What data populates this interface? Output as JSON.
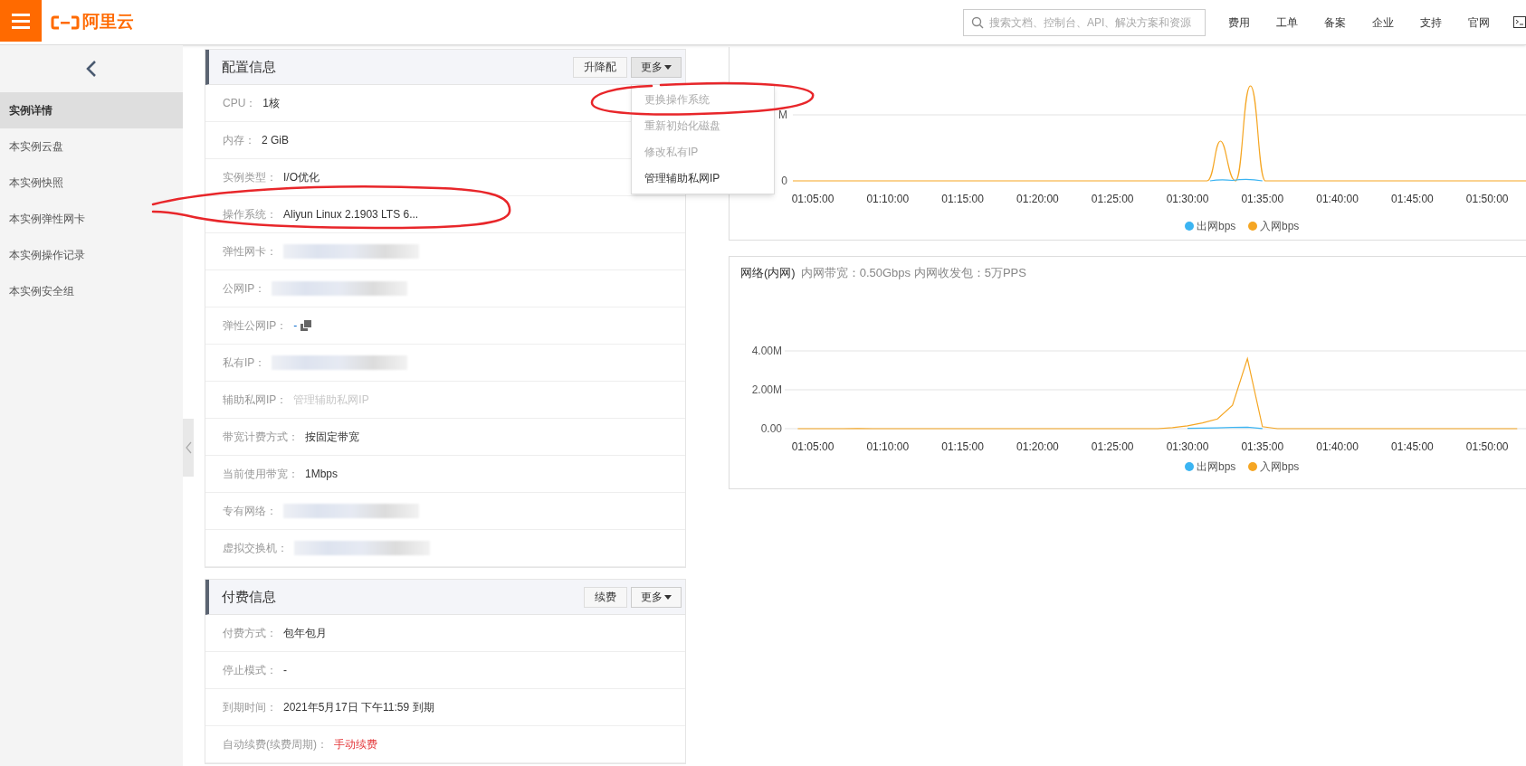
{
  "topbar": {
    "logo_text": "阿里云",
    "search": {
      "placeholder": "搜索文档、控制台、API、解决方案和资源"
    },
    "nav": [
      "费用",
      "工单",
      "备案",
      "企业",
      "支持",
      "官网"
    ]
  },
  "sidebar": {
    "items": [
      {
        "label": "实例详情",
        "selected": true
      },
      {
        "label": "本实例云盘",
        "selected": false
      },
      {
        "label": "本实例快照",
        "selected": false
      },
      {
        "label": "本实例弹性网卡",
        "selected": false
      },
      {
        "label": "本实例操作记录",
        "selected": false
      },
      {
        "label": "本实例安全组",
        "selected": false
      }
    ]
  },
  "config_panel": {
    "title": "配置信息",
    "buttons": [
      "升降配",
      "更多"
    ],
    "menu": [
      {
        "label": "更换操作系统",
        "disabled": true
      },
      {
        "label": "重新初始化磁盘",
        "disabled": true
      },
      {
        "label": "修改私有IP",
        "disabled": true
      },
      {
        "label": "管理辅助私网IP",
        "disabled": false
      }
    ],
    "rows": [
      {
        "label": "CPU：",
        "kind": "text",
        "value": "1核"
      },
      {
        "label": "内存：",
        "kind": "text",
        "value": "2 GiB"
      },
      {
        "label": "实例类型：",
        "kind": "text",
        "value": "I/O优化"
      },
      {
        "label": "操作系统：",
        "kind": "text",
        "value": "Aliyun Linux 2.1903 LTS 6..."
      },
      {
        "label": "弹性网卡：",
        "kind": "redacted"
      },
      {
        "label": "公网IP：",
        "kind": "redacted"
      },
      {
        "label": "弹性公网IP：",
        "kind": "copyable",
        "value": "-"
      },
      {
        "label": "私有IP：",
        "kind": "redacted"
      },
      {
        "label": "辅助私网IP：",
        "kind": "muted_link",
        "value": "管理辅助私网IP"
      },
      {
        "label": "带宽计费方式：",
        "kind": "text",
        "value": "按固定带宽"
      },
      {
        "label": "当前使用带宽：",
        "kind": "text",
        "value": "1Mbps"
      },
      {
        "label": "专有网络：",
        "kind": "redacted"
      },
      {
        "label": "虚拟交换机：",
        "kind": "redacted"
      }
    ]
  },
  "billing_panel": {
    "title": "付费信息",
    "buttons": [
      "续费",
      "更多"
    ],
    "rows": [
      {
        "label": "付费方式：",
        "kind": "text",
        "value": "包年包月"
      },
      {
        "label": "停止模式：",
        "kind": "text",
        "value": "-"
      },
      {
        "label": "到期时间：",
        "kind": "text",
        "value": "2021年5月17日 下午11:59 到期"
      },
      {
        "label": "自动续费(续费周期)：",
        "kind": "warning_link",
        "value": "手动续费"
      }
    ]
  },
  "public_chart": {
    "y_labels": [
      "M",
      "0"
    ],
    "x_labels": [
      "01:05:00",
      "01:10:00",
      "01:15:00",
      "01:20:00",
      "01:25:00",
      "01:30:00",
      "01:35:00",
      "01:40:00",
      "01:45:00",
      "01:50:00"
    ],
    "legend": [
      {
        "name": "出网bps",
        "color": "#3bb4f2"
      },
      {
        "name": "入网bps",
        "color": "#f5a623"
      }
    ]
  },
  "private_chart": {
    "title": "网络(内网)",
    "subtitle": "内网带宽：0.50Gbps 内网收发包：5万PPS",
    "chart_data": {
      "type": "line",
      "categories": [
        null,
        "01:05:00",
        null,
        null,
        null,
        null,
        "01:10:00",
        null,
        null,
        null,
        null,
        "01:15:00",
        null,
        null,
        null,
        null,
        "01:20:00",
        null,
        null,
        null,
        null,
        "01:25:00",
        null,
        null,
        null,
        null,
        "01:30:00",
        null,
        null,
        null,
        null,
        "01:35:00",
        null,
        null,
        null,
        null,
        "01:40:00",
        null,
        null,
        null,
        null,
        "01:45:00",
        null,
        null,
        null,
        null,
        "01:50:00",
        null,
        null
      ],
      "ylim": [
        0,
        4
      ],
      "yticks": [
        {
          "value": 0,
          "label": "0.00"
        },
        {
          "value": 2,
          "label": "2.00M"
        },
        {
          "value": 4,
          "label": "4.00M"
        }
      ],
      "series": [
        {
          "name": "出网bps",
          "color": "#3bb4f2",
          "values": [
            null,
            null,
            null,
            null,
            null,
            null,
            null,
            null,
            null,
            null,
            null,
            null,
            null,
            null,
            null,
            null,
            null,
            null,
            null,
            null,
            null,
            null,
            null,
            null,
            null,
            null,
            0.02,
            0.03,
            0.04,
            0.06,
            0.08,
            0.01,
            null,
            null,
            null,
            null,
            null,
            null,
            null,
            null,
            null,
            null,
            null,
            null,
            null,
            null,
            null,
            null,
            null
          ]
        },
        {
          "name": "入网bps",
          "color": "#f5a623",
          "values": [
            0,
            0,
            0,
            0,
            0.01,
            0,
            0,
            0,
            0,
            0,
            0,
            0,
            0,
            0,
            0,
            0,
            0,
            0,
            0,
            0,
            0,
            0,
            0,
            0,
            0,
            0.05,
            0.15,
            0.3,
            0.5,
            1.2,
            3.6,
            0.1,
            0,
            0,
            0,
            0,
            0,
            0,
            0,
            0,
            0,
            0,
            0,
            0,
            0,
            0,
            0,
            0,
            0
          ]
        }
      ]
    }
  }
}
